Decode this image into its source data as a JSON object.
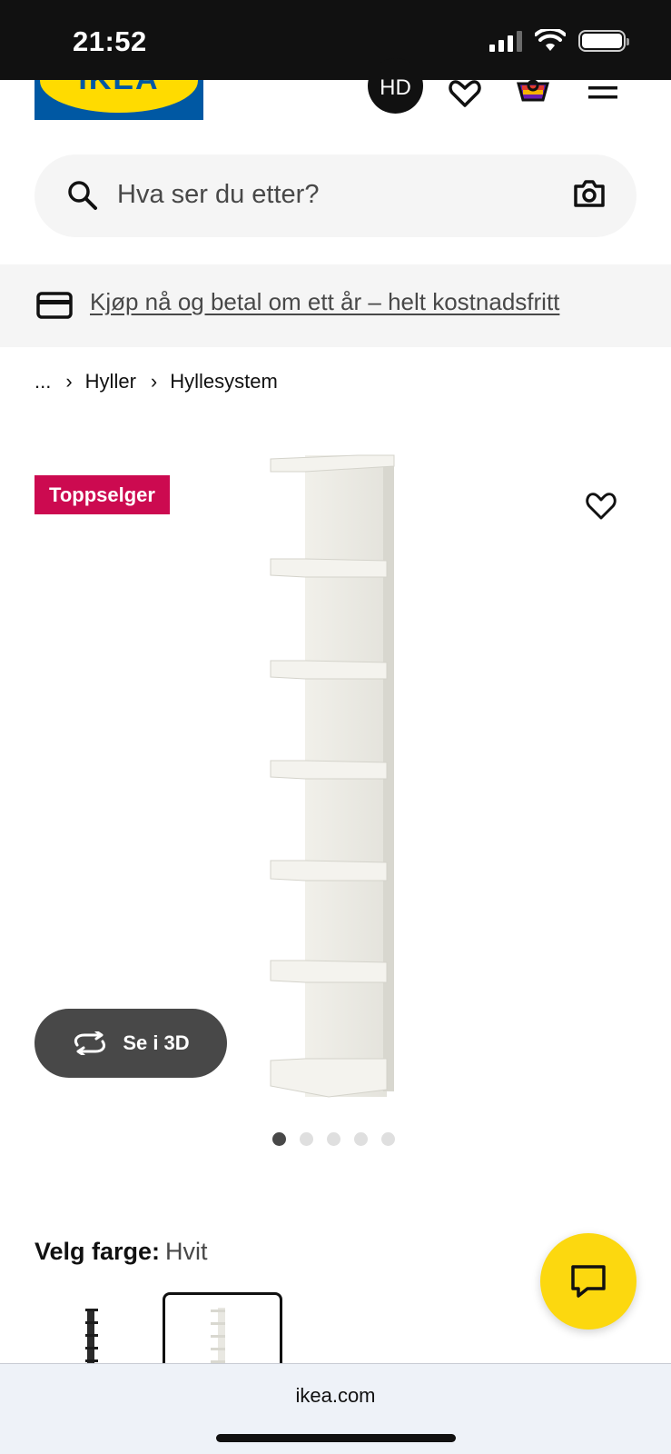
{
  "status_bar": {
    "time": "21:52"
  },
  "header": {
    "logo_text": "IKEA",
    "avatar_initials": "HD",
    "icons": [
      "heart-icon",
      "cart-icon",
      "menu-icon"
    ]
  },
  "search": {
    "placeholder": "Hva ser du etter?"
  },
  "promo": {
    "link_text": "Kjøp nå og betal om ett år – helt kostnadsfritt"
  },
  "breadcrumb": {
    "items": [
      "...",
      "Hyller",
      "Hyllesystem"
    ]
  },
  "product": {
    "badge": "Toppselger",
    "view_3d_label": "Se i 3D",
    "image_count": 5,
    "active_image_index": 0
  },
  "color": {
    "label": "Velg farge:",
    "value": "Hvit"
  },
  "browser": {
    "url": "ikea.com"
  },
  "colors": {
    "brand_blue": "#0058a3",
    "brand_yellow": "#ffdb00",
    "badge_red": "#cc0a50",
    "chat_yellow": "#fcd80f"
  }
}
